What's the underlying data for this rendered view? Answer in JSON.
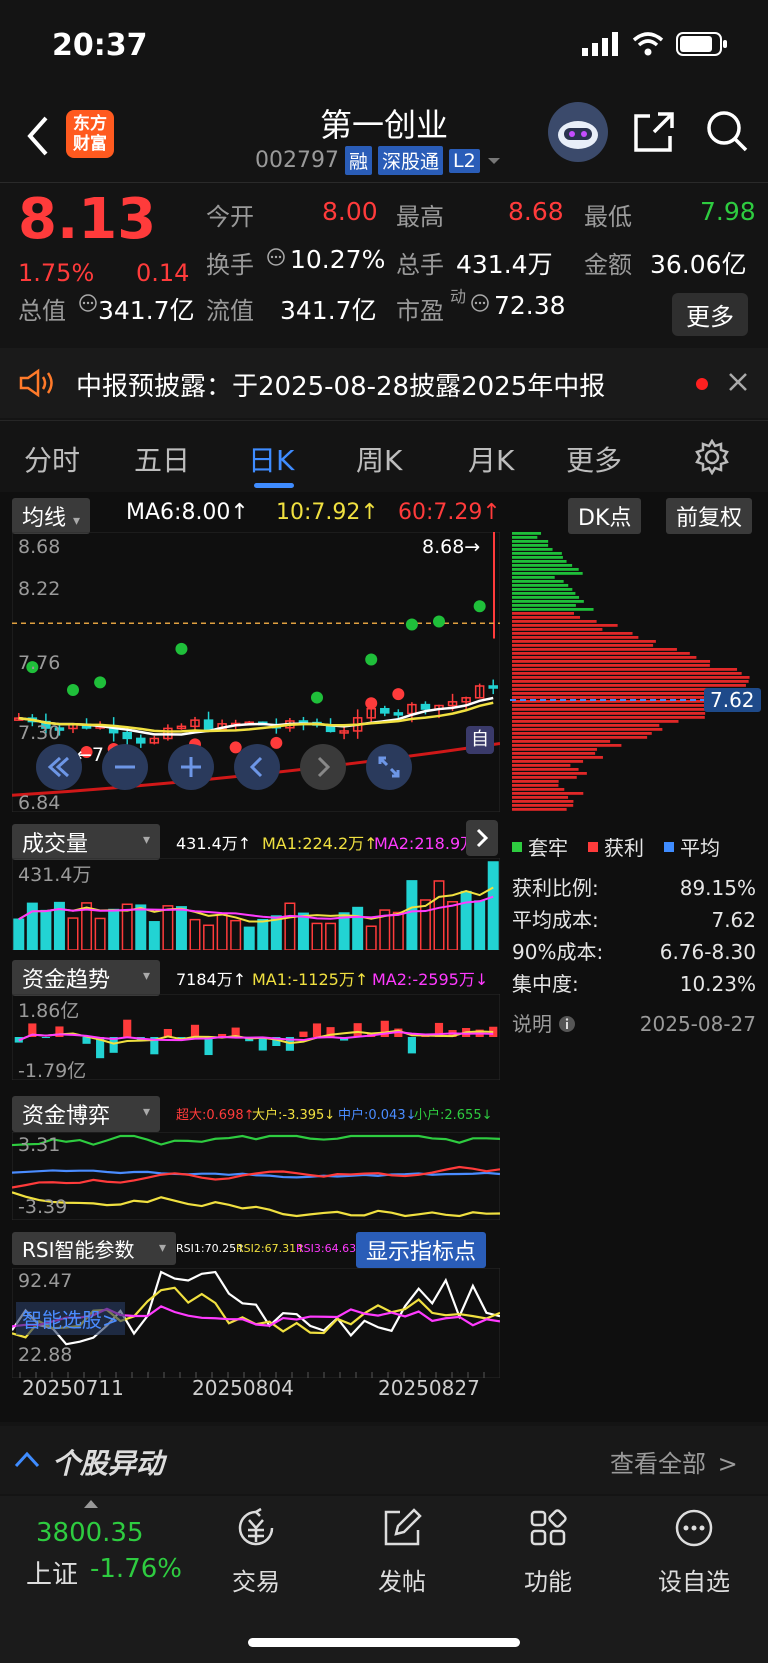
{
  "status_bar": {
    "time": "20:37"
  },
  "header": {
    "back_label": "<",
    "logo_text": "东方财富",
    "title": "第一创业",
    "code": "002797",
    "tags": [
      "融",
      "深股通",
      "L2"
    ]
  },
  "quote": {
    "price": "8.13",
    "change_pct": "1.75%",
    "change": "0.14",
    "open_label": "今开",
    "open": "8.00",
    "high_label": "最高",
    "high": "8.68",
    "low_label": "最低",
    "low": "7.98",
    "turnover_label": "换手",
    "turnover": "10.27%",
    "volume_label": "总手",
    "volume": "431.4万",
    "amount_label": "金额",
    "amount": "36.06亿",
    "total_mv_label": "总值",
    "total_mv": "341.7亿",
    "float_mv_label": "流值",
    "float_mv": "341.7亿",
    "pe_label": "市盈",
    "pe_sup": "动",
    "pe": "72.38",
    "more_label": "更多"
  },
  "notice": {
    "text": "中报预披露：于2025-08-28披露2025年中报"
  },
  "tabs": [
    {
      "label": "分时"
    },
    {
      "label": "五日"
    },
    {
      "label": "日K",
      "active": true
    },
    {
      "label": "周K"
    },
    {
      "label": "月K"
    },
    {
      "label": "更多"
    }
  ],
  "kline": {
    "indicator_dropdown": "均线",
    "ma6": "MA6:8.00↑",
    "ma10": "10:7.92↑",
    "ma60": "60:7.29↑",
    "dk_button": "DK点",
    "adjust_button": "前复权",
    "y_labels": [
      "8.68",
      "8.22",
      "7.76",
      "7.30",
      "6.84"
    ],
    "high_marker": "8.68→",
    "low_marker": "←7.26",
    "self_badge": "自",
    "cost_marker": "7.62"
  },
  "chip": {
    "legend": [
      "套牢",
      "获利",
      "平均"
    ],
    "profit_ratio_label": "获利比例:",
    "profit_ratio": "89.15%",
    "avg_cost_label": "平均成本:",
    "avg_cost": "7.62",
    "cost90_label": "90%成本:",
    "cost90": "6.76-8.30",
    "concentration_label": "集中度:",
    "concentration": "10.23%",
    "explain_label": "说明",
    "date": "2025-08-27"
  },
  "volume": {
    "dropdown": "成交量",
    "total": "431.4万↑",
    "ma1": "MA1:224.2万↑",
    "ma2": "MA2:218.9万↑",
    "y_label": "431.4万"
  },
  "fund_trend": {
    "dropdown": "资金趋势",
    "value": "7184万↑",
    "ma1": "MA1:-1125万↑",
    "ma2": "MA2:-2595万↓",
    "y_top": "1.86亿",
    "y_bottom": "-1.79亿"
  },
  "fund_game": {
    "dropdown": "资金博弈",
    "super": "超大:0.698↑",
    "big": "大户:-3.395↓",
    "mid": "中户:0.043↓",
    "small": "小户:2.655↓",
    "y_top": "3.31",
    "y_bottom": "-3.39"
  },
  "rsi": {
    "dropdown": "RSI智能参数",
    "rsi1": "RSI1:70.25↑",
    "rsi2": "RSI2:67.31↑",
    "rsi3": "RSI3:64.63↑",
    "show_points": "显示指标点",
    "y_top": "92.47",
    "y_bottom": "22.88",
    "smart_pick": "智能选股"
  },
  "dates": [
    "20250711",
    "20250804",
    "20250827"
  ],
  "abnormal": {
    "title": "个股异动",
    "view_all": "查看全部"
  },
  "tabbar": {
    "index_value": "3800.35",
    "index_name": "上证",
    "index_change": "-1.76%",
    "items": [
      {
        "label": "交易"
      },
      {
        "label": "发帖"
      },
      {
        "label": "功能"
      },
      {
        "label": "设自选"
      }
    ]
  },
  "colors": {
    "up": "#ff3b3b",
    "down": "#2ecc40",
    "accent": "#2a5db8"
  }
}
